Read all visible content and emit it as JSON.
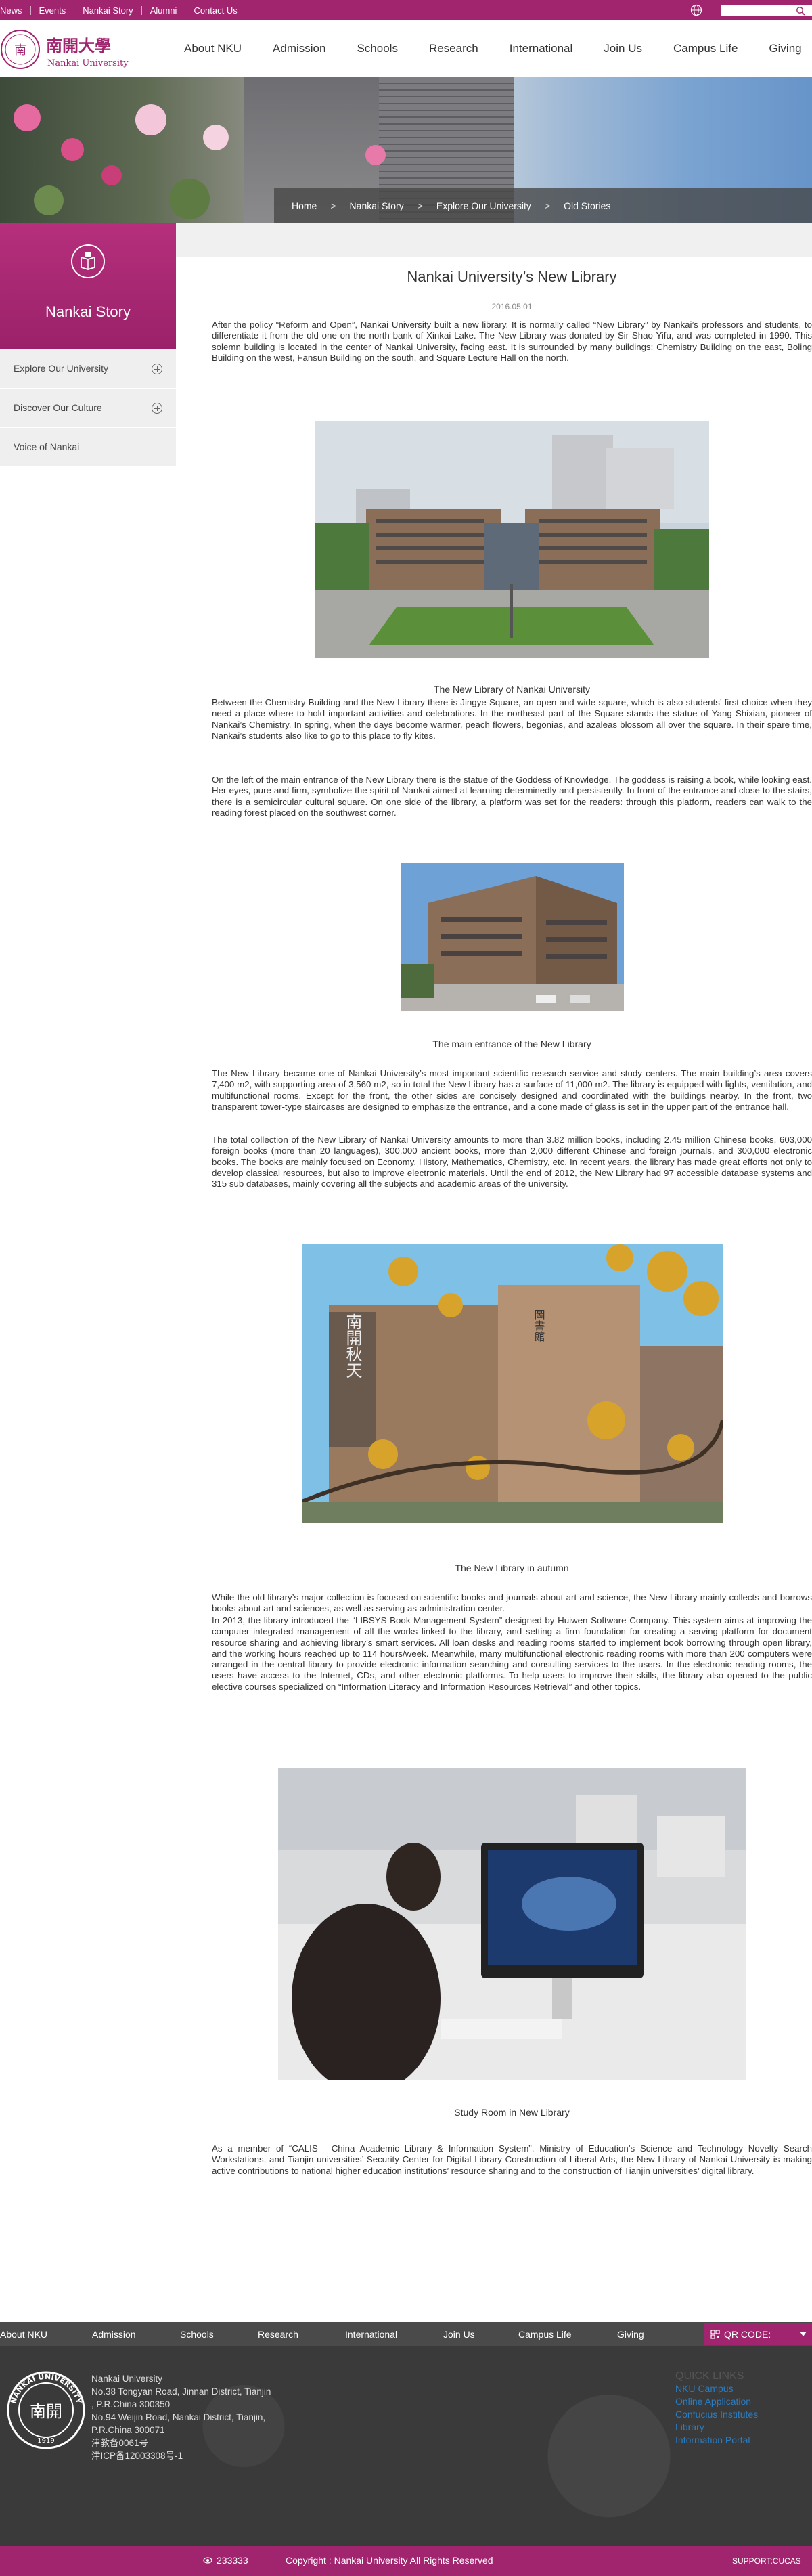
{
  "topbar": {
    "links": [
      "News",
      "Events",
      "Nankai Story",
      "Alumni",
      "Contact Us"
    ],
    "search_placeholder": ""
  },
  "header": {
    "logo_cn": "南開大學",
    "logo_en": "Nankai University",
    "nav": [
      "About NKU",
      "Admission",
      "Schools",
      "Research",
      "International",
      "Join Us",
      "Campus Life",
      "Giving"
    ]
  },
  "breadcrumb": [
    "Home",
    "Nankai Story",
    "Explore Our University",
    "Old Stories"
  ],
  "sidebar": {
    "title": "Nankai Story",
    "items": [
      {
        "label": "Explore Our University",
        "expandable": true
      },
      {
        "label": "Discover Our Culture",
        "expandable": true
      },
      {
        "label": "Voice of Nankai",
        "expandable": false
      }
    ]
  },
  "article": {
    "title": "Nankai University’s New Library",
    "date": "2016.05.01",
    "p1": "After the policy “Reform and Open”, Nankai University built a new library. It is normally called “New Library” by Nankai’s professors and students, to differentiate it from the old one on the north bank of Xinkai Lake. The New Library was donated by Sir Shao Yifu, and was completed in 1990. This solemn building is located in the center of Nankai University, facing east. It is surrounded by many buildings: Chemistry Building on the east, Boling Building on the west, Fansun Building on the south, and Square Lecture Hall on the north.",
    "cap1": "The New Library of Nankai University",
    "p2": "Between the Chemistry Building and the New Library there is Jingye Square, an open and wide square, which is also students’ first choice when they need a place where to hold important activities and celebrations. In the northeast part of the Square stands the statue of Yang Shixian, pioneer of Nankai’s Chemistry. In spring, when the days become warmer, peach flowers, begonias, and azaleas blossom all over the square. In their spare time, Nankai’s students also like to go to this place to fly kites.",
    "p3": "On the left of the main entrance of the New Library there is the statue of the Goddess of Knowledge. The goddess is raising a book, while looking east. Her eyes, pure and firm, symbolize the spirit of Nankai aimed at learning determinedly and persistently. In front of the entrance and close to the stairs, there is a semicircular cultural square. On one side of the library, a platform was set for the readers: through this platform, readers can walk to the reading forest placed on the southwest corner.",
    "cap2": "The main entrance of the New Library",
    "p4": "The New Library became one of Nankai University’s most important scientific research service and study centers. The main building’s area covers 7,400 m2, with supporting area of 3,560 m2, so in total the New Library has a surface of 11,000 m2. The library is equipped with lights, ventilation, and multifunctional rooms. Except for the front, the other sides are concisely designed and coordinated with the buildings nearby. In the front, two transparent tower-type staircases are designed to emphasize the entrance, and a cone made of glass is set in the upper part of the entrance hall.",
    "p5": "The total collection of the New Library of Nankai University amounts to more than 3.82 million books, including 2.45 million Chinese books, 603,000 foreign books (more than 20 languages), 300,000 ancient books, more than 2,000 different Chinese and foreign journals, and 300,000 electronic books. The books are mainly focused on Economy, History, Mathematics, Chemistry, etc. In recent years, the library has made great efforts not only to develop classical resources, but also to improve electronic materials. Until the end of 2012, the New Library had 97 accessible database systems and 315 sub databases, mainly covering all the subjects and academic areas of the university.",
    "cap3": "The New Library in autumn",
    "p6": "While the old library’s major collection is focused on scientific books and journals about art and science, the New Library mainly collects and borrows books about art and sciences, as well as serving as administration center.",
    "p7": "In 2013, the library introduced the “LIBSYS Book Management System” designed by Huiwen Software Company. This system aims at improving the computer integrated management of all the works linked to the library, and setting a firm foundation for creating a serving platform for document resource sharing and achieving library’s smart services. All loan desks and reading rooms started to implement book borrowing through open library, and the working hours reached up to 114 hours/week. Meanwhile, many multifunctional electronic reading rooms with more than 200 computers were arranged in the central library to provide electronic information searching and consulting services to the users. In the electronic reading rooms, the users have access to the Internet, CDs, and other electronic platforms. To help users to improve their skills, the library also opened to the public elective courses specialized on “Information Literacy and Information Resources Retrieval” and other topics.",
    "cap4": "Study Room in New Library",
    "p8": "As a member of “CALIS - China Academic Library & Information System”, Ministry of Education’s Science and Technology Novelty Search Workstations, and Tianjin universities’ Security Center for Digital Library Construction of Liberal Arts, the New Library of Nankai University is making active contributions to national higher education institutions’ resource sharing and to the construction of Tianjin universities’ digital library."
  },
  "photo_text": {
    "autumn_plaque": "南開秋天",
    "autumn_sign": "圖書館"
  },
  "footer_nav": [
    "About NKU",
    "Admission",
    "Schools",
    "Research",
    "International",
    "Join Us",
    "Campus Life",
    "Giving"
  ],
  "qr_label": "QR CODE:",
  "footer": {
    "seal_top": "NANKAI UNIVERSITY",
    "seal_year": "1919",
    "address": [
      "Nankai University",
      "No.38 Tongyan Road, Jinnan District, Tianjin",
      ", P.R.China 300350",
      "No.94 Weijin Road,  Nankai District, Tianjin,",
      "P.R.China  300071",
      "津教备0061号",
      "津ICP备12003308号-1"
    ],
    "quick_heading": "QUICK LINKS",
    "quick_links": [
      "NKU Campus",
      "Online Application",
      "Confucius Institutes",
      "Library",
      "Information Portal"
    ]
  },
  "copyright": {
    "counter": "233333",
    "text": "Copyright : Nankai University All Rights Reserved",
    "support": "SUPPORT:CUCAS"
  },
  "colors": {
    "brand": "#a0246e",
    "footer": "#3a3a3a",
    "link": "#2a7cc0"
  }
}
